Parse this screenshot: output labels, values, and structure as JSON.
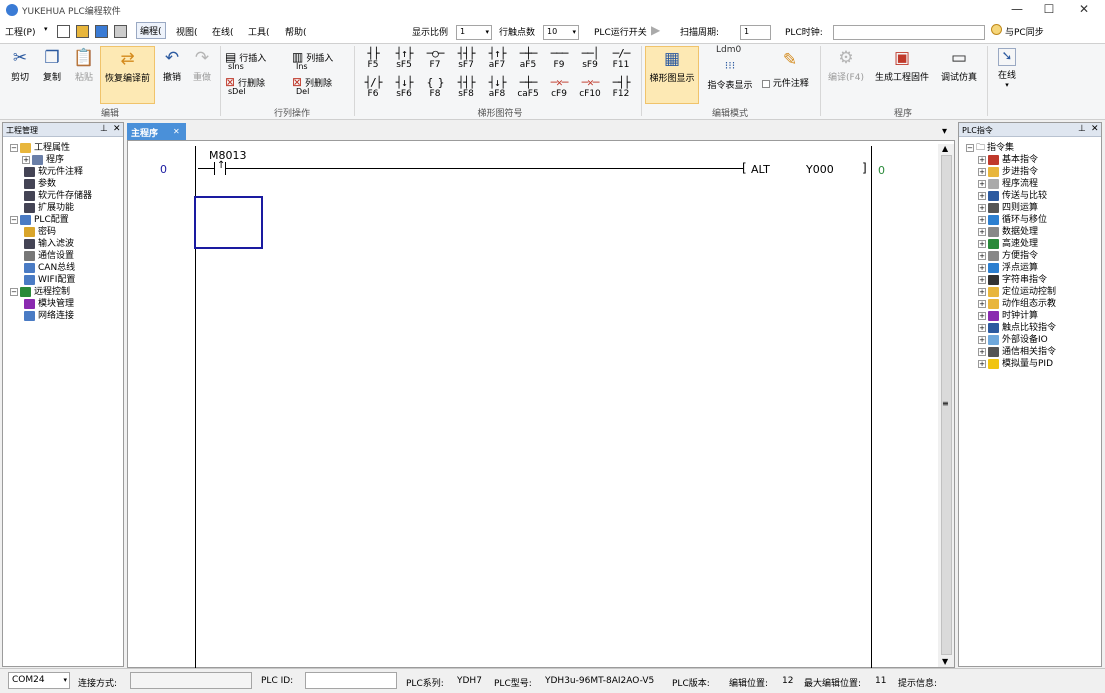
{
  "window": {
    "title": "YUKEHUA PLC编程软件",
    "min": "—",
    "max": "☐",
    "close": "✕"
  },
  "menu": {
    "items": [
      "工程(P)",
      "编程(",
      "视图(",
      "在线(",
      "工具(",
      "帮助("
    ],
    "scale_label": "显示比例",
    "scale_value": "1",
    "contacts_label": "行触点数",
    "contacts_value": "10",
    "run_label": "PLC运行开关",
    "scan_label": "扫描周期:",
    "scan_value": "1",
    "clock_label": "PLC时钟:",
    "clock_value": "",
    "sync_label": "与PC同步"
  },
  "ribbon": {
    "edit": {
      "cut": "剪切",
      "copy": "复制",
      "paste": "粘贴",
      "restore": "恢复编译前",
      "undo": "撤销",
      "redo": "重做",
      "group": "编辑"
    },
    "rowcol": {
      "ins_row": "行插入",
      "del_row": "行删除",
      "ins_col": "列插入",
      "del_col": "列删除",
      "sIns": "sIns",
      "sDel": "sDel",
      "Ins": "Ins",
      "Del": "Del",
      "group": "行列操作"
    },
    "symbols": {
      "row1": [
        "F5",
        "sF5",
        "F7",
        "sF7",
        "aF7",
        "aF5",
        "F9",
        "sF9",
        "F11"
      ],
      "row2": [
        "F6",
        "sF6",
        "F8",
        "sF8",
        "aF8",
        "caF5",
        "cF9",
        "cF10",
        "F12"
      ],
      "group": "梯形图符号"
    },
    "mode": {
      "ladder": "梯形图显示",
      "inst": "指令表显示",
      "ldm": "Ldm0",
      "comment": "元件注释",
      "group": "编辑模式"
    },
    "program": {
      "compile": "编译(F4)",
      "gen": "生成工程固件",
      "debug": "调试仿真",
      "group": "程序"
    },
    "online": {
      "label": "在线"
    }
  },
  "left_panel": {
    "title": "工程管理",
    "pin": "⊥",
    "close": "✕",
    "tree": [
      {
        "label": "工程属性",
        "level": 0,
        "exp": "⊟",
        "color": "#e8b63c"
      },
      {
        "label": "程序",
        "level": 1,
        "exp": "⊞",
        "color": "#6a7fa8"
      },
      {
        "label": "软元件注释",
        "level": 1,
        "exp": "",
        "color": "#445"
      },
      {
        "label": "参数",
        "level": 1,
        "exp": "",
        "color": "#445"
      },
      {
        "label": "软元件存储器",
        "level": 1,
        "exp": "",
        "color": "#445"
      },
      {
        "label": "扩展功能",
        "level": 1,
        "exp": "",
        "color": "#445"
      },
      {
        "label": "PLC配置",
        "level": 0,
        "exp": "⊟",
        "color": "#4a7bc4"
      },
      {
        "label": "密码",
        "level": 1,
        "exp": "",
        "color": "#d9a52b"
      },
      {
        "label": "输入滤波",
        "level": 1,
        "exp": "",
        "color": "#445"
      },
      {
        "label": "通信设置",
        "level": 1,
        "exp": "",
        "color": "#777"
      },
      {
        "label": "CAN总线",
        "level": 1,
        "exp": "",
        "color": "#4a7bc4"
      },
      {
        "label": "WIFI配置",
        "level": 1,
        "exp": "",
        "color": "#4a7bc4"
      },
      {
        "label": "远程控制",
        "level": 0,
        "exp": "⊟",
        "color": "#2a8a3a"
      },
      {
        "label": "模块管理",
        "level": 1,
        "exp": "",
        "color": "#8a2ab0"
      },
      {
        "label": "网络连接",
        "level": 1,
        "exp": "",
        "color": "#4a7bc4"
      }
    ]
  },
  "right_panel": {
    "title": "PLC指令",
    "pin": "⊥",
    "close": "✕",
    "root": "指令集",
    "items": [
      {
        "label": "基本指令",
        "color": "#c0392b"
      },
      {
        "label": "步进指令",
        "color": "#e8b63c"
      },
      {
        "label": "程序流程",
        "color": "#aaa"
      },
      {
        "label": "传送与比较",
        "color": "#2c5aa0"
      },
      {
        "label": "四则运算",
        "color": "#555"
      },
      {
        "label": "循环与移位",
        "color": "#2c7fd0"
      },
      {
        "label": "数据处理",
        "color": "#888"
      },
      {
        "label": "高速处理",
        "color": "#2a8a3a"
      },
      {
        "label": "方便指令",
        "color": "#888"
      },
      {
        "label": "浮点运算",
        "color": "#2c7fd0"
      },
      {
        "label": "字符串指令",
        "color": "#333"
      },
      {
        "label": "定位运动控制",
        "color": "#e8b63c"
      },
      {
        "label": "动作组态示教",
        "color": "#e8b63c"
      },
      {
        "label": "时钟计算",
        "color": "#8a2ab0"
      },
      {
        "label": "触点比较指令",
        "color": "#2c5aa0"
      },
      {
        "label": "外部设备IO",
        "color": "#6fa8dc"
      },
      {
        "label": "通信相关指令",
        "color": "#555"
      },
      {
        "label": "模拟量与PID",
        "color": "#f1c40f"
      }
    ]
  },
  "tab": {
    "label": "主程序",
    "close": "✕",
    "dropdown": "▾"
  },
  "ladder": {
    "step": "0",
    "contact": "M8013",
    "contact_symbol": "─|↑|─",
    "inst": "ALT",
    "operand": "Y000",
    "end_step": "0",
    "bracket_open": "[",
    "bracket_close": "]"
  },
  "status": {
    "port": "COM24",
    "conn_label": "连接方式:",
    "conn_value": "",
    "id_label": "PLC ID:",
    "id_value": "",
    "series_label": "PLC系列:",
    "series_value": "YDH7",
    "model_label": "PLC型号:",
    "model_value": "YDH3u-96MT-8AI2AO-V5",
    "ver_label": "PLC版本:",
    "edit_label": "编辑位置:",
    "edit_value": "12",
    "max_label": "最大编辑位置:",
    "max_value": "11",
    "tip_label": "提示信息:"
  },
  "colors": {
    "accent": "#4a90d9",
    "selection": "#1a1aa0",
    "highlight": "#fde9b4",
    "end_step": "#2a8a3a"
  }
}
